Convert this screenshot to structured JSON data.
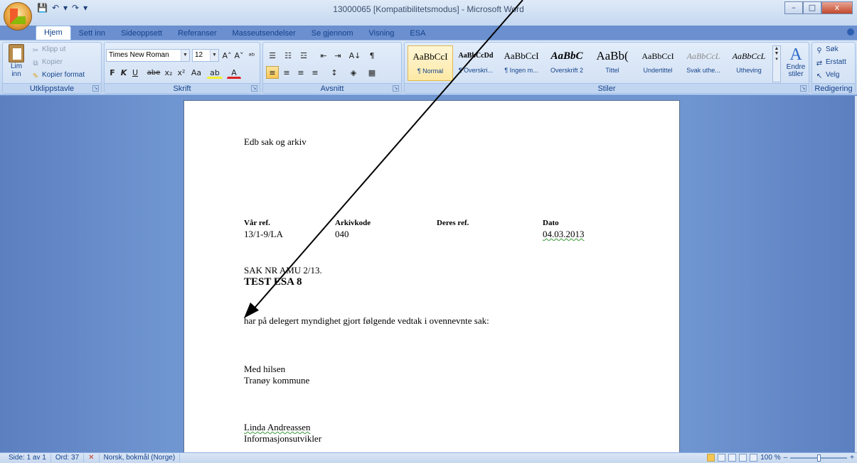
{
  "window": {
    "title": "13000065 [Kompatibilitetsmodus] - Microsoft Word",
    "minimize_glyph": "–",
    "maximize_glyph": "□",
    "close_glyph": "x"
  },
  "qat": {
    "save_icon": "💾",
    "undo_icon": "↶",
    "undo_drop": "▾",
    "redo_icon": "↷",
    "customize_icon": "▾"
  },
  "tabs": [
    "Hjem",
    "Sett inn",
    "Sideoppsett",
    "Referanser",
    "Masseutsendelser",
    "Se gjennom",
    "Visning",
    "ESA"
  ],
  "ribbon": {
    "clipboard": {
      "label": "Utklippstavle",
      "paste": "Lim",
      "paste2": "inn",
      "cut": "Klipp ut",
      "copy": "Kopier",
      "format_painter": "Kopier format"
    },
    "font": {
      "label": "Skrift",
      "font_name": "Times New Roman",
      "font_size": "12",
      "grow": "A˄",
      "shrink": "A˅",
      "clear": "ᵃᵇ",
      "bold": "F",
      "italic": "K",
      "underline": "U",
      "strike": "abe",
      "subscript": "x₂",
      "superscript": "x²",
      "change_case": "Aa",
      "highlight": "ab",
      "font_color": "A"
    },
    "paragraph": {
      "label": "Avsnitt",
      "bullets": "☰",
      "numbering": "☷",
      "multilevel": "☲",
      "outdent": "⇤",
      "indent": "⇥",
      "sort": "A↓",
      "pilcrow": "¶",
      "align_left": "≡",
      "align_center": "≡",
      "align_right": "≡",
      "justify": "≡",
      "line_spacing": "↕",
      "shading": "◈",
      "borders": "▦"
    },
    "styles": {
      "label": "Stiler",
      "items": [
        {
          "sample": "AaBbCcI",
          "name": "¶ Normal"
        },
        {
          "sample": "AaBbCcDd",
          "name": "¶ Overskri..."
        },
        {
          "sample": "AaBbCcI",
          "name": "¶ Ingen m..."
        },
        {
          "sample": "AaBbC",
          "name": "Overskrift 2"
        },
        {
          "sample": "AaBb(",
          "name": "Tittel"
        },
        {
          "sample": "AaBbCcI",
          "name": "Undertittel"
        },
        {
          "sample": "AaBbCcL",
          "name": "Svak uthe..."
        },
        {
          "sample": "AaBbCcL",
          "name": "Utheving"
        }
      ],
      "change_styles": "Endre",
      "change_styles2": "stiler"
    },
    "editing": {
      "label": "Redigering",
      "find": "Søk",
      "replace": "Erstatt",
      "select": "Velg"
    }
  },
  "document": {
    "org": "Edb sak og arkiv",
    "headers": {
      "var_ref_label": "Vår ref.",
      "var_ref": "13/1-9/LA",
      "arkivkode_label": "Arkivkode",
      "arkivkode": "040",
      "deres_ref_label": "Deres ref.",
      "dato_label": "Dato",
      "dato": "04.03.2013"
    },
    "sak_nr": "SAK NR AMU  2/13.",
    "title": "TEST ESA 8",
    "body": "har på delegert myndighet gjort følgende vedtak i ovennevnte sak:",
    "closing": "Med hilsen",
    "municipality": "Tranøy kommune",
    "signer": "Linda  Andreassen",
    "signer_title": "Informasjonsutvikler"
  },
  "statusbar": {
    "page": "Side: 1 av 1",
    "words": "Ord: 37",
    "language": "Norsk, bokmål (Norge)",
    "zoom": "100 %",
    "zoom_out": "–",
    "zoom_in": "+"
  },
  "colors": {
    "ribbon_bg": "#c8daf2",
    "doc_bg": "#7096d1",
    "accent": "#15428b"
  }
}
